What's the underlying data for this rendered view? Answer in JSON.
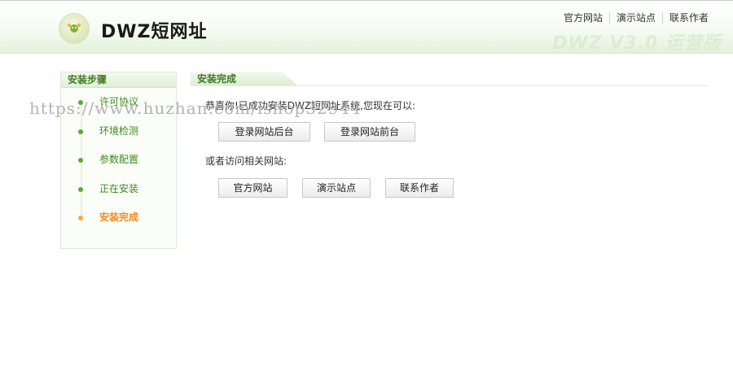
{
  "header": {
    "logo_text": "DWZ短网址",
    "version_text": "DWZ V3.0 运营版",
    "links": [
      "官方网站",
      "演示站点",
      "联系作者"
    ]
  },
  "sidebar": {
    "title": "安装步骤",
    "steps": [
      "许可协议",
      "环境检测",
      "参数配置",
      "正在安装",
      "安装完成"
    ],
    "current_step": "安装完成"
  },
  "main": {
    "tab_title": "安装完成",
    "message": "恭喜你!已成功安装DWZ短网址系统,您现在可以:",
    "buttons_primary": [
      "登录网站后台",
      "登录网站前台"
    ],
    "message2": "或者访问相关网站:",
    "buttons_secondary": [
      "官方网站",
      "演示站点",
      "联系作者"
    ]
  },
  "watermark": "https://www.huzhan.com/ishop32944",
  "colors": {
    "accent_green": "#3f8a1c",
    "current_orange": "#f28c1c"
  }
}
